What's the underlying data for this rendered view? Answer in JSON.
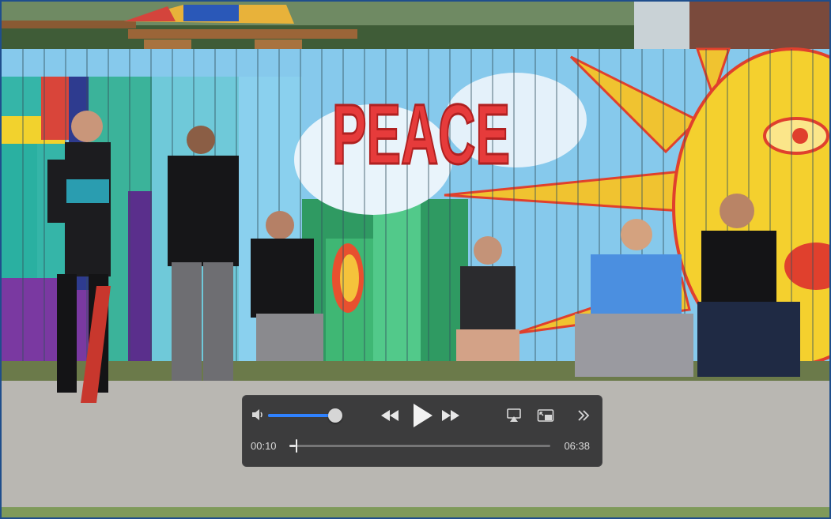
{
  "player": {
    "current_time": "00:10",
    "duration": "06:38",
    "progress": 0.025,
    "volume": 0.9,
    "accent_color": "#2f82ff"
  },
  "mural": {
    "painted_text": "PEACE"
  },
  "icons": {
    "volume": "speaker-icon",
    "rewind": "rewind-icon",
    "play": "play-icon",
    "fast_forward": "fast-forward-icon",
    "airplay": "airplay-icon",
    "pip": "picture-in-picture-icon",
    "more": "chevron-double-right-icon"
  }
}
